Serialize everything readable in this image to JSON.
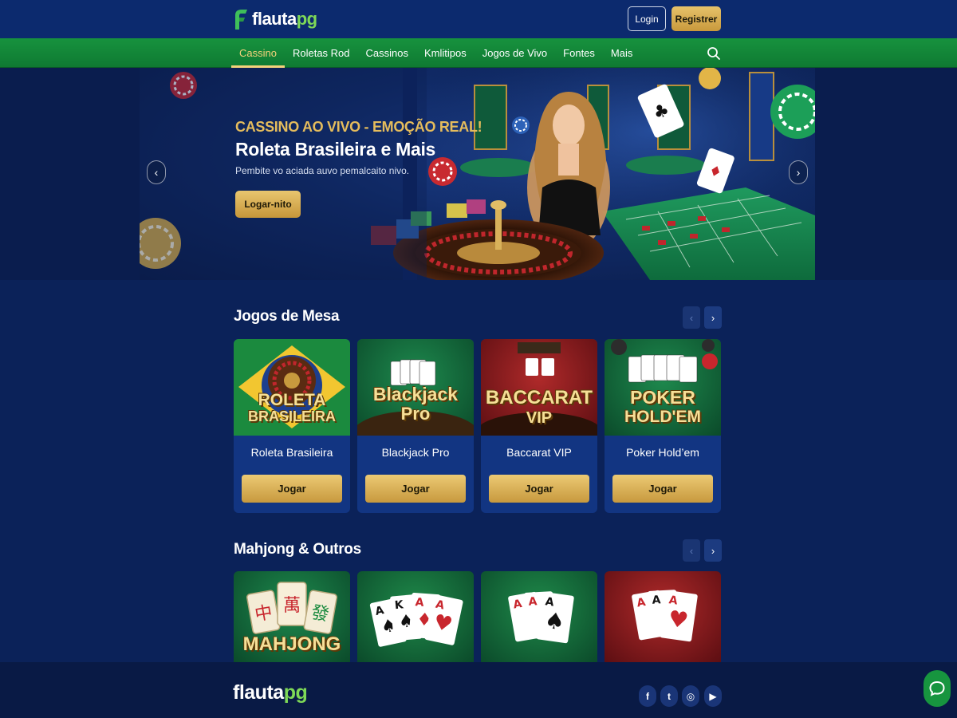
{
  "brand": {
    "name_main": "flauta",
    "name_accent": "pg"
  },
  "header": {
    "login_label": "Login",
    "register_label": "Registrer"
  },
  "nav": {
    "items": [
      {
        "label": "Cassino",
        "active": true
      },
      {
        "label": "Roletas Rod",
        "active": false
      },
      {
        "label": "Cassinos",
        "active": false
      },
      {
        "label": "Kmlitipos",
        "active": false
      },
      {
        "label": "Jogos de Vivo",
        "active": false
      },
      {
        "label": "Fontes",
        "active": false
      },
      {
        "label": "Mais",
        "active": false
      }
    ],
    "search_icon": "search-icon"
  },
  "hero": {
    "kicker": "CASSINO AO VIVO - EMOÇÃO REAL!",
    "title": "Roleta Brasileira e Mais",
    "subtitle": "Pembite vo aciada auvo pemalcaito nivo.",
    "cta_label": "Logar-nito",
    "prev_icon": "chevron-left-icon",
    "next_icon": "chevron-right-icon"
  },
  "sections": [
    {
      "title": "Jogos de Mesa",
      "games": [
        {
          "name": "Roleta Brasileira",
          "thumb_label_1": "ROLETA",
          "thumb_label_2": "BRASILEIRA",
          "play_label": "Jogar"
        },
        {
          "name": "Blackjack Pro",
          "thumb_label_1": "Blackjack",
          "thumb_label_2": "Pro",
          "play_label": "Jogar"
        },
        {
          "name": "Baccarat VIP",
          "thumb_label_1": "BACCARAT",
          "thumb_label_2": "VIP",
          "play_label": "Jogar"
        },
        {
          "name": "Poker Hold’em",
          "thumb_label_1": "POKER",
          "thumb_label_2": "HOLD'EM",
          "play_label": "Jogar"
        }
      ]
    },
    {
      "title": "Mahjong & Outros",
      "games": [
        {
          "thumb_label": "MAHJONG",
          "tiles": [
            "中",
            "萬",
            "發"
          ]
        },
        {
          "cards": [
            "A",
            "K",
            "A",
            "A"
          ]
        },
        {
          "cards": [
            "A",
            "A",
            "A"
          ]
        },
        {
          "cards": [
            "A",
            "A",
            "A"
          ]
        }
      ]
    }
  ],
  "footer": {
    "brand_main": "flauta",
    "brand_accent": "pg",
    "social": [
      {
        "label": "f",
        "icon": "facebook-icon"
      },
      {
        "label": "t",
        "icon": "twitter-icon"
      },
      {
        "label": "◎",
        "icon": "instagram-icon"
      },
      {
        "label": "▶",
        "icon": "youtube-icon"
      }
    ]
  },
  "colors": {
    "accent_gold": "#e5bc5c",
    "nav_green": "#17923e",
    "page_bg": "#0b2259",
    "brand_green": "#7ed957"
  }
}
